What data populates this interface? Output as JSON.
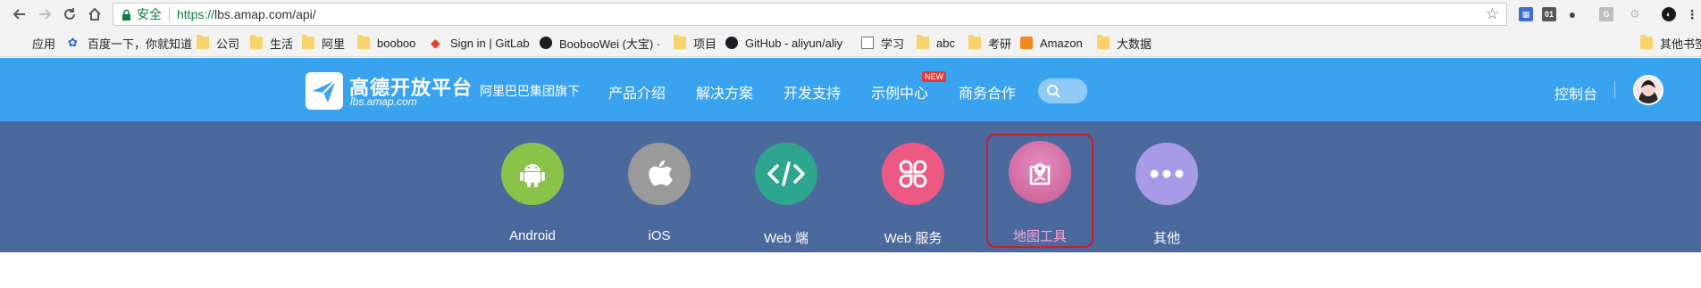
{
  "browser": {
    "secure_label": "安全",
    "url_scheme": "https://",
    "url_rest": "lbs.amap.com/api/"
  },
  "bookmarks": [
    {
      "label": "应用",
      "icon": "apps-grid-icon"
    },
    {
      "label": "百度一下，你就知道",
      "icon": "baidu-paw-icon"
    },
    {
      "label": "公司",
      "icon": "folder-icon"
    },
    {
      "label": "生活",
      "icon": "folder-icon"
    },
    {
      "label": "阿里",
      "icon": "folder-icon"
    },
    {
      "label": "booboo",
      "icon": "folder-icon"
    },
    {
      "label": "Sign in | GitLab",
      "icon": "gitlab-icon"
    },
    {
      "label": "BoobooWei (大宝) ·",
      "icon": "github-icon"
    },
    {
      "label": "项目",
      "icon": "folder-icon"
    },
    {
      "label": "GitHub - aliyun/aliy",
      "icon": "github-icon"
    },
    {
      "label": "学习",
      "icon": "page-icon"
    },
    {
      "label": "abc",
      "icon": "folder-icon"
    },
    {
      "label": "考研",
      "icon": "folder-icon"
    },
    {
      "label": "Amazon",
      "icon": "amazon-icon"
    },
    {
      "label": "大数据",
      "icon": "folder-icon"
    },
    {
      "label": "其他书签",
      "icon": "folder-icon"
    }
  ],
  "header": {
    "logo_title": "高德开放平台",
    "logo_sub": "lbs.amap.com",
    "subtitle": "阿里巴巴集团旗下",
    "nav": [
      "产品介绍",
      "解决方案",
      "开发支持",
      "示例中心",
      "商务合作"
    ],
    "new_badge": "NEW",
    "console": "控制台"
  },
  "platforms": [
    {
      "label": "Android",
      "color": "#8bc34a",
      "icon": "android-icon"
    },
    {
      "label": "iOS",
      "color": "#9a9a9a",
      "icon": "apple-icon"
    },
    {
      "label": "Web 端",
      "color": "#2ea58e",
      "icon": "code-icon"
    },
    {
      "label": "Web 服务",
      "color": "#ec5a84",
      "icon": "clover-icon"
    },
    {
      "label": "地图工具",
      "color": "#d86aa0",
      "icon": "map-pin-icon",
      "selected": true
    },
    {
      "label": "其他",
      "color": "#a79be8",
      "icon": "more-icon"
    }
  ],
  "colors": {
    "header_bg": "#3aa3f0",
    "band_bg": "#4b699d",
    "selected_border": "#c8202a"
  }
}
